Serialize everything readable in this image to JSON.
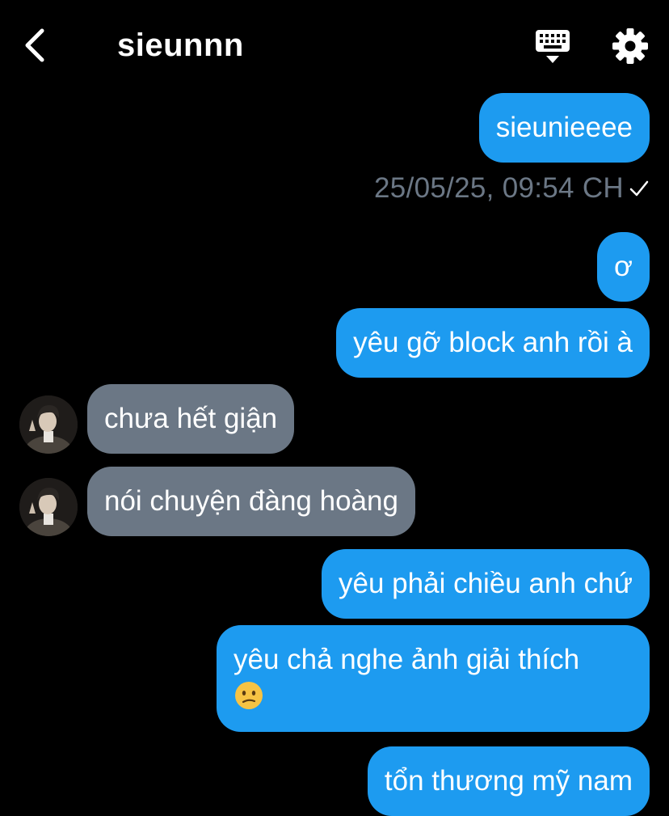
{
  "header": {
    "title": "sieunnn",
    "back_icon": "chevron-left-icon",
    "keyboard_icon": "keyboard-icon",
    "settings_icon": "gear-icon"
  },
  "messages": [
    {
      "direction": "outgoing",
      "text": "sieunieeee"
    },
    {
      "direction": "outgoing",
      "text": "ơ"
    },
    {
      "direction": "outgoing",
      "text": "yêu gỡ block anh rồi à"
    },
    {
      "direction": "incoming",
      "text": "chưa hết giận"
    },
    {
      "direction": "incoming",
      "text": "nói chuyện đàng hoàng"
    },
    {
      "direction": "outgoing",
      "text": "yêu phải chiều anh chứ"
    },
    {
      "direction": "outgoing",
      "text": "yêu chả nghe ảnh giải thích",
      "emoji": "confused-face-emoji"
    },
    {
      "direction": "outgoing",
      "text": "tổn thương mỹ nam"
    }
  ],
  "timestamp": "25/05/25, 09:54 CH",
  "colors": {
    "outgoing_bubble": "#1d9bf0",
    "incoming_bubble": "#6b7785",
    "background": "#000000",
    "timestamp": "#6b7785"
  }
}
